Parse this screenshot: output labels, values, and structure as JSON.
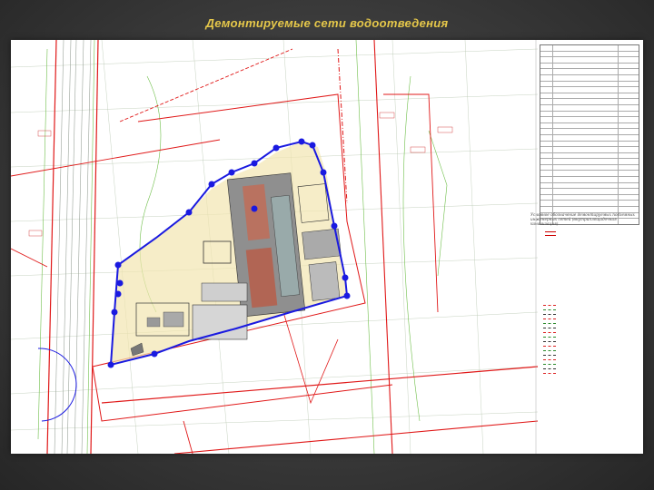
{
  "slide": {
    "title": "Демонтируемые сети водоотведения"
  },
  "map": {
    "colors": {
      "boundary": "#1a1ae0",
      "redline": "#e01818",
      "roads": "#c8c8c8",
      "greenery": "#6fbf4a",
      "background": "#ffffff"
    }
  },
  "legend": {
    "table_title": "",
    "rows": [
      {
        "num": "",
        "name": "",
        "note": ""
      },
      {
        "num": "",
        "name": "",
        "note": ""
      },
      {
        "num": "",
        "name": "",
        "note": ""
      },
      {
        "num": "",
        "name": "",
        "note": ""
      },
      {
        "num": "",
        "name": "",
        "note": ""
      },
      {
        "num": "",
        "name": "",
        "note": ""
      },
      {
        "num": "",
        "name": "",
        "note": ""
      },
      {
        "num": "",
        "name": "",
        "note": ""
      },
      {
        "num": "",
        "name": "",
        "note": ""
      },
      {
        "num": "",
        "name": "",
        "note": ""
      },
      {
        "num": "",
        "name": "",
        "note": ""
      },
      {
        "num": "",
        "name": "",
        "note": ""
      },
      {
        "num": "",
        "name": "",
        "note": ""
      },
      {
        "num": "",
        "name": "",
        "note": ""
      },
      {
        "num": "",
        "name": "",
        "note": ""
      },
      {
        "num": "",
        "name": "",
        "note": ""
      },
      {
        "num": "",
        "name": "",
        "note": ""
      },
      {
        "num": "",
        "name": "",
        "note": ""
      },
      {
        "num": "",
        "name": "",
        "note": ""
      },
      {
        "num": "",
        "name": "",
        "note": ""
      },
      {
        "num": "",
        "name": "",
        "note": ""
      },
      {
        "num": "",
        "name": "",
        "note": ""
      },
      {
        "num": "",
        "name": "",
        "note": ""
      },
      {
        "num": "",
        "name": "",
        "note": ""
      },
      {
        "num": "",
        "name": "",
        "note": ""
      },
      {
        "num": "",
        "name": "",
        "note": ""
      },
      {
        "num": "",
        "name": "",
        "note": ""
      },
      {
        "num": "",
        "name": "",
        "note": ""
      },
      {
        "num": "",
        "name": "",
        "note": ""
      },
      {
        "num": "",
        "name": "",
        "note": ""
      }
    ],
    "note_text": "Условное обозначение демонтируемых подземных инженерных сетей (внутриплощадочная канализация)",
    "symbol_text": "",
    "conditions_title": "",
    "conditions": [
      "",
      "",
      "",
      "",
      "",
      "",
      "",
      "",
      "",
      "",
      "",
      "",
      "",
      "",
      "",
      ""
    ],
    "footnotes": [
      "",
      "",
      "",
      ""
    ]
  }
}
